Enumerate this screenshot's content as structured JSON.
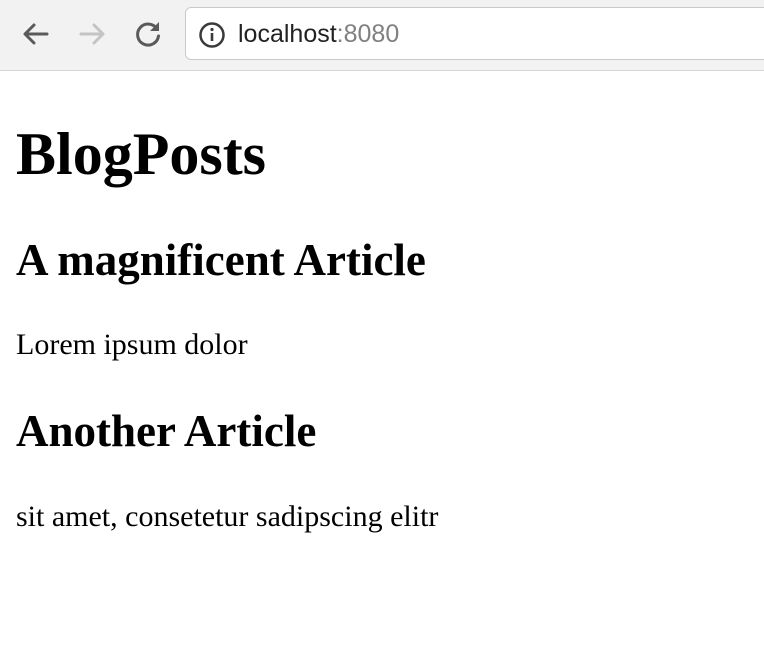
{
  "browser": {
    "back_icon": "arrow-left-icon",
    "forward_icon": "arrow-right-icon",
    "reload_icon": "reload-icon",
    "info_icon": "info-circle-icon",
    "url_host": "localhost",
    "url_port": ":8080",
    "forward_enabled": false
  },
  "page": {
    "title": "BlogPosts",
    "articles": [
      {
        "title": "A magnificent Article",
        "body": "Lorem ipsum dolor"
      },
      {
        "title": "Another Article",
        "body": "sit amet, consetetur sadipscing elitr"
      }
    ]
  }
}
